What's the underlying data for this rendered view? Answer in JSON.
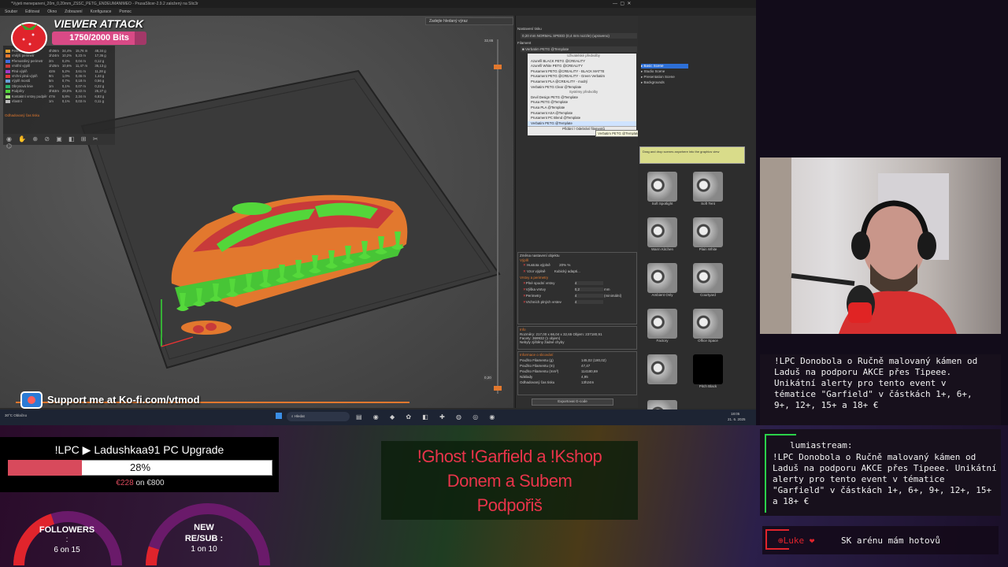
{
  "slicer": {
    "window_title": "*Vyjeti menepaneni_20m_0,20mm_ZSSC_PETG_ENDEUMANIMEO - PrusaSlicer-2.9.2 založený na Slic3r",
    "menu": [
      "Soubor",
      "Editovat",
      "Okno",
      "Zobrazení",
      "Konfigurace",
      "Pomoc"
    ],
    "search_placeholder": "Zadejte hledaný výraz",
    "expert_mode": "Expertní režim",
    "login": "Přihlásit se",
    "print_settings_label": "Nastavení tisku",
    "print_profile": "0,20 mm NORMAL SPEED (0,4 mm nozzle) (upraveno)",
    "filament_label": "Filament",
    "filament_selected": "Verbatim PETG @Template",
    "dropdown_items": [
      "Uživatelské předvolby",
      "Azurefil BLACK PETG @CREALITY",
      "Azurefil White PETG @CREALITY",
      "Prusament PETG @CREALITY - BLACK MATTE",
      "Prusament PETG @CREALITY - Green Verbatim",
      "Prusament PLA @CREALITY - modrý",
      "Verbatim PETG Clear @Template",
      "Systémy předvolby",
      "Devil Design PETG @Template",
      "Prusa PETG @Template",
      "Prusa PLA @Template",
      "Prusament ASA @Template",
      "Prusament PC Blend @Template",
      "Verbatim PETG @Template",
      "Přidání / Odebrání filamentů"
    ],
    "tooltip": "Verbatim PETG @Template",
    "object_settings_title": "Změna nastavení objektu",
    "infill_section": "Výplň",
    "infill_density_label": "Hustota výplně",
    "infill_density_value": "20%",
    "infill_pattern_label": "Vzor výplně",
    "infill_pattern_value": "Kubický adapti...",
    "layers_section": "Vrstvy a perimetry",
    "layers_rows": [
      {
        "label": "Plné spodní vrstvy",
        "value": "4"
      },
      {
        "label": "Výška vrstvy",
        "value": "0,2",
        "unit": "mm"
      },
      {
        "label": "Perimetry",
        "value": "4",
        "unit": "(minimální)"
      },
      {
        "label": "Vrchních plných vrstev",
        "value": "4"
      }
    ],
    "info_title": "Info",
    "info_rows": [
      "Rozměry: 217,00 x 66,04 x 32,65  Objem: 237180,91",
      "Facety: 369932 (1 objem)",
      "Nebyly zjištěny žádné chyby"
    ],
    "sliced_title": "Informace o slicování",
    "sliced_rows": [
      {
        "label": "Použito Filamentu (g)",
        "value": "145,02 (180,02)"
      },
      {
        "label": "Použito Filamentu (m)",
        "value": "47,47"
      },
      {
        "label": "Použito Filamentu (mm³)",
        "value": "114180,69"
      },
      {
        "label": "Náklady",
        "value": "4,95"
      },
      {
        "label": "Odhadovaný čas tisku",
        "value": "13h24m"
      }
    ],
    "export_button": "Exportovat G-code",
    "layer_top": "32,65",
    "layer_bottom": "0,20",
    "stats_header": "Odhadovaný čas tisku",
    "stats_rows": [
      {
        "name": "Perimetr",
        "t": "4h36m",
        "p": "34,4%",
        "m": "15,76 m",
        "g": "48,34 g"
      },
      {
        "name": "Vnější perimetr",
        "t": "1h24m",
        "p": "10,2%",
        "m": "5,23 m",
        "g": "17,36 g"
      },
      {
        "name": "Přemostěný perimetr",
        "t": "2m",
        "p": "0,2%",
        "m": "0,04 m",
        "g": "0,12 g"
      },
      {
        "name": "Vnitřní výplň",
        "t": "1h25m",
        "p": "10,6%",
        "m": "11,47 m",
        "g": "35,13 g"
      },
      {
        "name": "Plná výplň",
        "t": "42m",
        "p": "5,2%",
        "m": "3,61 m",
        "g": "11,28 g"
      },
      {
        "name": "Vrchní plná výplň",
        "t": "9m",
        "p": "1,0%",
        "m": "0,46 m",
        "g": "1,44 g"
      },
      {
        "name": "Výplň mostů",
        "t": "5m",
        "p": "0,7%",
        "m": "0,18 m",
        "g": "0,56 g"
      },
      {
        "name": "Obrysová linie",
        "t": "1m",
        "p": "0,1%",
        "m": "0,07 m",
        "g": "0,22 g"
      },
      {
        "name": "Podpěry",
        "t": "3h53m",
        "p": "29,0%",
        "m": "8,22 m",
        "g": "25,27 g"
      },
      {
        "name": "Kontaktní vrstvy podpěr",
        "t": "47m",
        "p": "5,8%",
        "m": "2,34 m",
        "g": "6,83 g"
      },
      {
        "name": "Vlastní",
        "t": "1m",
        "p": "0,1%",
        "m": "0,03 m",
        "g": "0,11 g"
      }
    ],
    "right_app": {
      "items": [
        "Basic Scene",
        "Studio Scene",
        "Presentation Scene",
        "Backgrounds"
      ],
      "drop_hint": "Drag and drop scenes anywhere into the graphics view",
      "thumbs": [
        "Soft Spotlight",
        "Soft Tent",
        "Warm Kitchen",
        "Plain White",
        "Ambient Only",
        "Courtyard",
        "Factory",
        "Office Space",
        "",
        "Pitch Black",
        "Studio Room 2"
      ]
    },
    "taskbar_search": "Hledat",
    "weather": "30°C Oblačno",
    "clock_time": "18:05",
    "clock_date": "21. 6. 2025"
  },
  "overlay": {
    "viewer_attack": "VIEWER ATTACK",
    "bits": "1750/2000 Bits",
    "kofi": "Support me at Ko-fi.com/vtmod",
    "goal_title": "!LPC ▶ Ladushkaa91 PC Upgrade",
    "goal_percent_text": "28%",
    "goal_fraction": 0.28,
    "goal_current": "€228",
    "goal_on": "on",
    "goal_target": "€800",
    "followers_label": "FOLLOWERS",
    "followers_colon": ":",
    "followers_value": "6 on 15",
    "followers_fraction": 0.4,
    "newsub_label": "NEW RE/SUB :",
    "newsub_value": "1 on 10",
    "newsub_fraction": 0.1,
    "banner_lines": [
      "!Ghost  !Garfield a !Kshop",
      "Donem a Subem",
      "Podpořiš"
    ],
    "chat_message_1": "!LPC Donobola o Ručně malovaný kámen od Laduš na podporu AKCE přes Tipeee. Unikátní alerty pro tento event v tématice \"Garfield\" v částkách 1+, 6+, 9+, 12+, 15+ a 18+ €",
    "chat_user_2": "lumiastream:",
    "chat_message_2": "!LPC Donobola o Ručně malovaný kámen od Laduš na podporu AKCE přes Tipeee. Unikátní alerty pro tento event v tématice \"Garfield\" v částkách 1+, 6+, 9+, 12+, 15+ a 18+ €",
    "ticker_user": "Luke",
    "ticker_text": "SK arénu mám hotovů"
  },
  "colors": {
    "accent_pink": "#d94a86",
    "goal_fill": "#d84a5c",
    "banner_red": "#e8344a",
    "model_orange": "#e2782e",
    "model_red": "#c83a3a",
    "model_green": "#53d63a"
  }
}
